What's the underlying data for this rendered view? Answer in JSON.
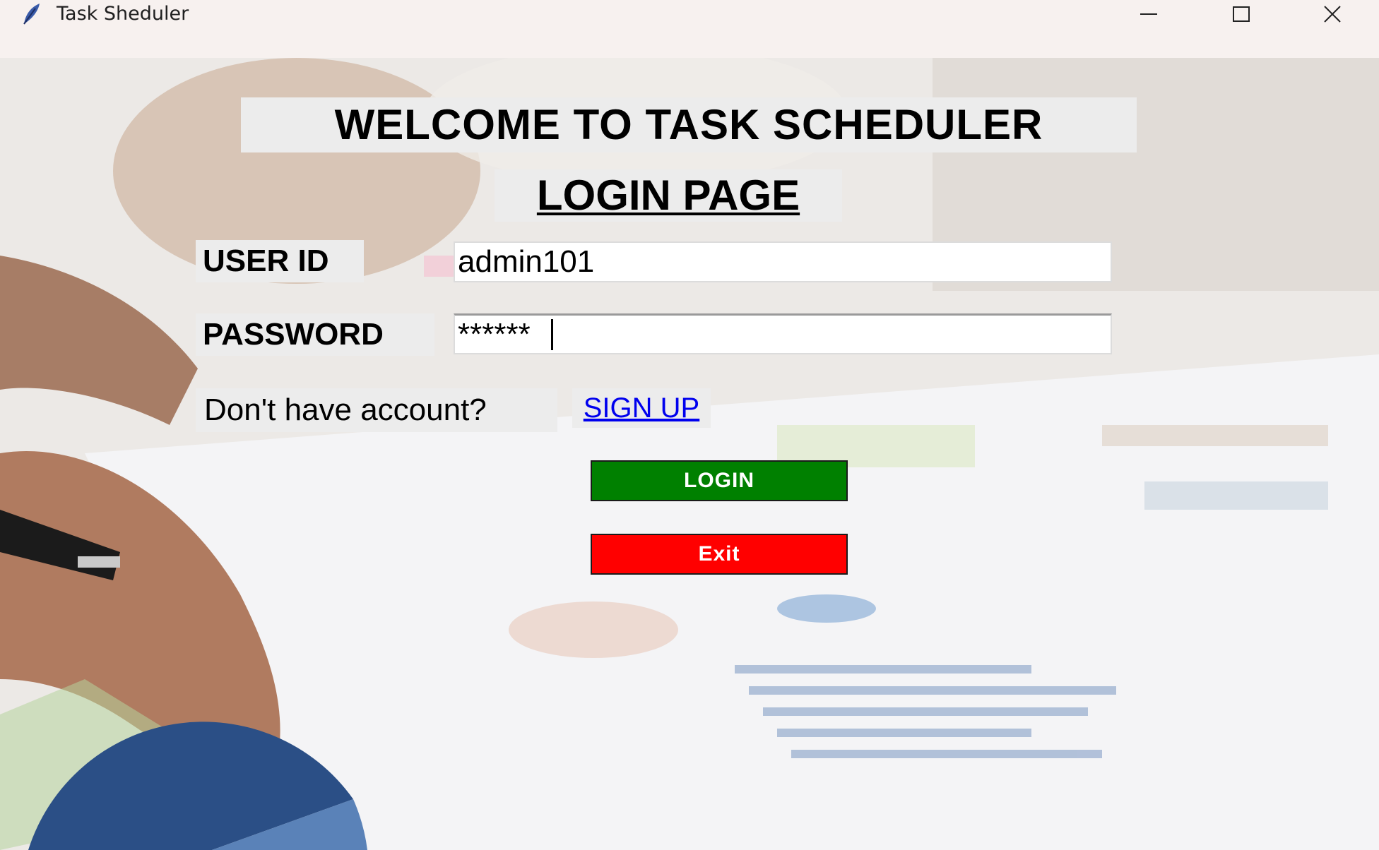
{
  "window": {
    "title": "Task Sheduler",
    "icon": "feather-icon",
    "controls": [
      "minimize-icon",
      "maximize-icon",
      "close-icon"
    ]
  },
  "page": {
    "welcome_heading": "WELCOME TO TASK SCHEDULER",
    "login_heading": "LOGIN PAGE"
  },
  "form": {
    "user_id_label": "USER ID",
    "user_id_value": "admin101",
    "password_label": "PASSWORD",
    "password_value": "******",
    "no_account_text": "Don't have account?",
    "signup_link": "SIGN UP",
    "login_button": "LOGIN",
    "exit_button": "Exit"
  },
  "colors": {
    "login_button": "#008000",
    "exit_button": "#ff0000",
    "signup_link": "#0000ee",
    "label_background": "#ececec"
  }
}
